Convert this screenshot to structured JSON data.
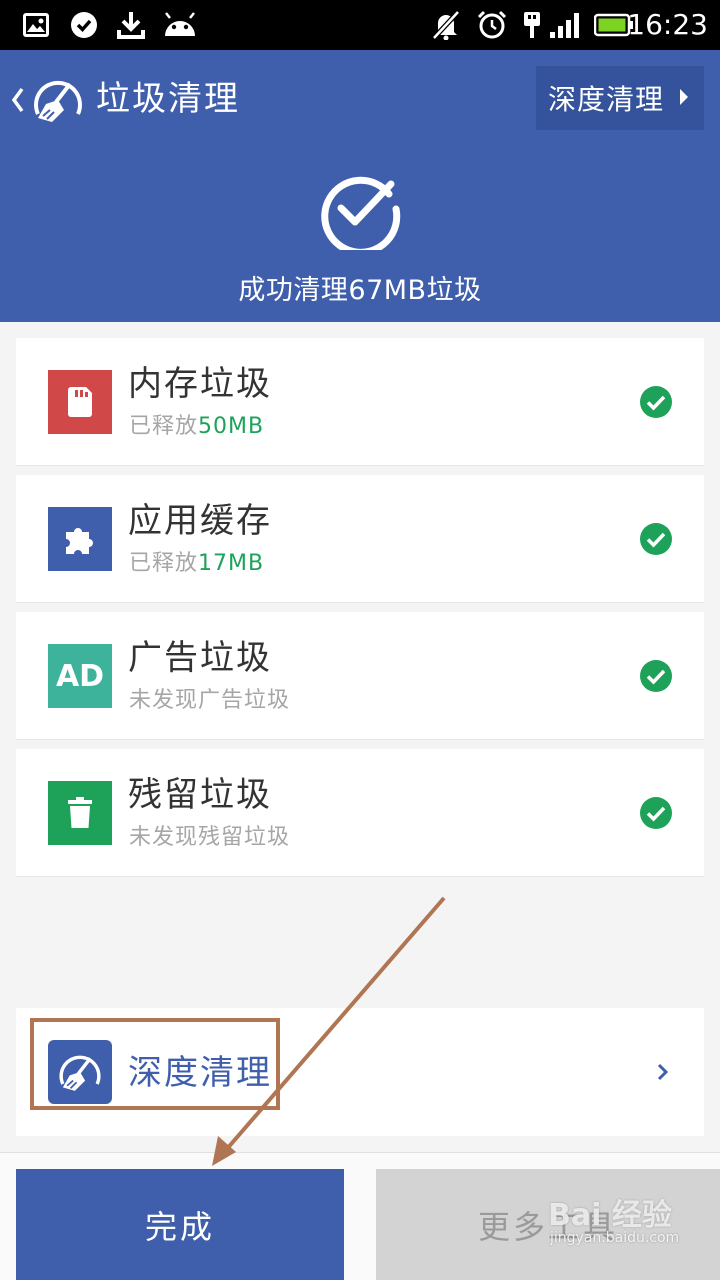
{
  "status_bar": {
    "time": "16:23",
    "icons": [
      "image-icon",
      "check-circle-icon",
      "download-icon",
      "android-icon",
      "bell-off-icon",
      "alarm-icon",
      "usb-icon",
      "signal-icon",
      "battery-icon"
    ]
  },
  "header": {
    "title": "垃圾清理",
    "deep_clean_label": "深度清理",
    "success_text": "成功清理67MB垃圾"
  },
  "items": [
    {
      "title": "内存垃圾",
      "sub_prefix": "已释放",
      "sub_value": "50MB",
      "icon": "sd-card-icon",
      "color": "#d04848"
    },
    {
      "title": "应用缓存",
      "sub_prefix": "已释放",
      "sub_value": "17MB",
      "icon": "puzzle-icon",
      "color": "#3f5eab"
    },
    {
      "title": "广告垃圾",
      "sub_prefix": "未发现广告垃圾",
      "sub_value": "",
      "icon": "ad-icon",
      "icon_text": "AD",
      "color": "#3eb39c"
    },
    {
      "title": "残留垃圾",
      "sub_prefix": "未发现残留垃圾",
      "sub_value": "",
      "icon": "trash-icon",
      "color": "#1ea25a"
    }
  ],
  "deep_clean": {
    "label": "深度清理"
  },
  "bottom": {
    "done_label": "完成",
    "more_tools_label": "更多工具"
  },
  "watermark": {
    "main": "Bai 经验",
    "sub": "jingyan.baidu.com"
  },
  "colors": {
    "primary": "#3f5eab",
    "success": "#1ea25a",
    "annotation": "#b07654"
  }
}
